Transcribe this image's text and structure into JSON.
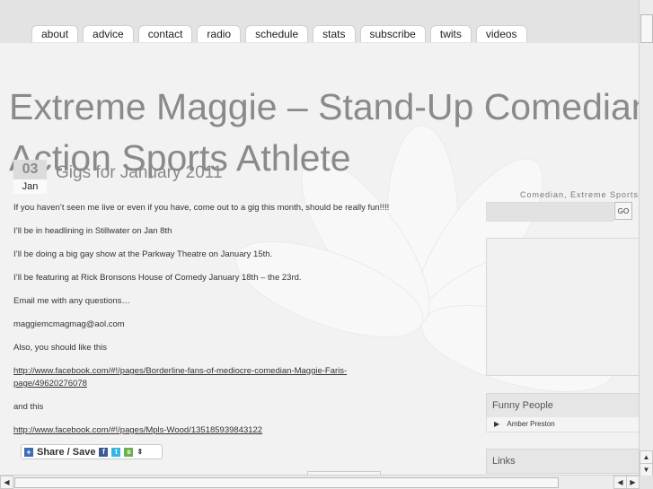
{
  "nav": {
    "tabs": [
      "about",
      "advice",
      "contact",
      "radio",
      "schedule",
      "stats",
      "subscribe",
      "twits",
      "videos"
    ]
  },
  "header": {
    "site_title": "Extreme Maggie – Stand-Up Comedian, Action Sports Athlete"
  },
  "post": {
    "date_day": "03",
    "date_month": "Jan",
    "title": "Gigs for January 2011",
    "paragraphs": [
      "If you haven’t seen me live or even if you have, come out to a gig this month, should be really fun!!!!",
      "I’ll be in headlining in Stillwater on Jan 8th",
      "I’ll be doing a big gay show at the Parkway Theatre on January 15th.",
      "I’ll be featuring at Rick Bronsons House of Comedy January 18th – the 23rd.",
      "Email me with any questions…",
      "maggiemcmagmag@aol.com",
      "Also, you should like this"
    ],
    "link1": "http://www.facebook.com/#!/pages/Borderline-fans-of-mediocre-comedian-Maggie-Faris-page/49620276078",
    "and_this": "and this",
    "link2": "http://www.facebook.com/#!/pages/Mpls-Wood/135185939843122",
    "share_label": "Share / Save"
  },
  "sidebar": {
    "tagline": "Comedian, Extreme Sports A",
    "search_placeholder": "",
    "search_button": "GO",
    "funny_people_heading": "Funny People",
    "funny_people": [
      "Amber Preston"
    ],
    "links_heading": "Links"
  },
  "icons": {
    "share": "plus-icon",
    "facebook": "facebook-icon",
    "twitter": "twitter-icon",
    "more": "more-services-icon"
  }
}
